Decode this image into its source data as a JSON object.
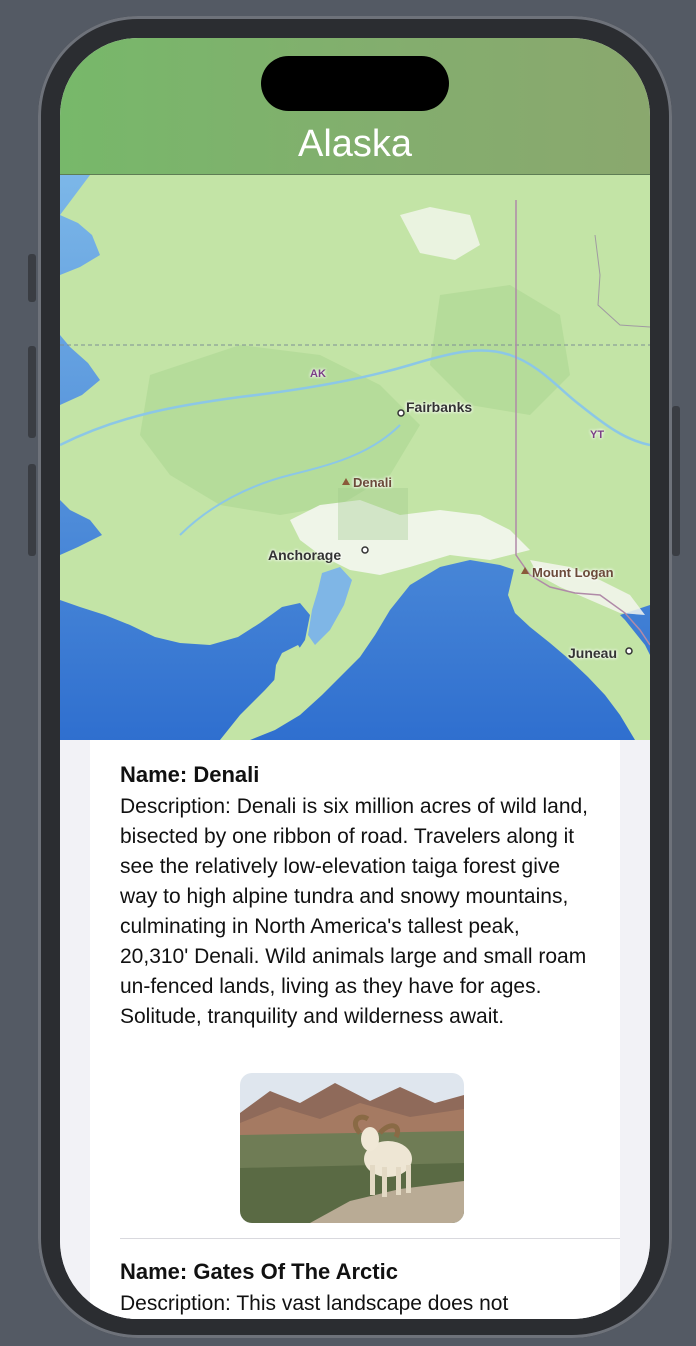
{
  "nav": {
    "title": "Alaska"
  },
  "map": {
    "labels": {
      "ak": "AK",
      "yt": "YT",
      "fairbanks": "Fairbanks",
      "denali": "Denali",
      "anchorage": "Anchorage",
      "mount_logan": "Mount Logan",
      "juneau": "Juneau"
    }
  },
  "parks": [
    {
      "name": "Name: Denali",
      "description": "Description: Denali is six million acres of wild land, bisected by one ribbon of road. Travelers along it see the relatively low-elevation taiga forest give way to high alpine tundra and snowy mountains, culminating in North America's tallest peak, 20,310' Denali. Wild animals large and small roam un-fenced lands, living as they have for ages. Solitude, tranquility and wilderness await."
    },
    {
      "name": "Name: Gates Of The Arctic",
      "description": "Description: This vast landscape does not"
    }
  ],
  "colors": {
    "nav_bar": "#7fb36c",
    "map_land": "#bfe3a3",
    "map_water": "#6aa8e0"
  }
}
